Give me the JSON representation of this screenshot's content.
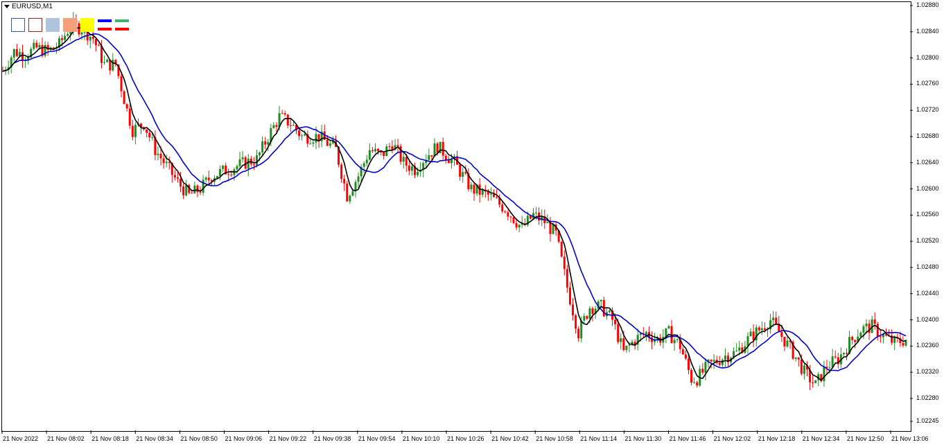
{
  "window": {
    "symbol_title": "EURUSD,M1"
  },
  "toolbox": {
    "swatches": [
      {
        "name": "outline-blue-rect-tool",
        "fill": "#ffffff",
        "border": "#3a5a8a"
      },
      {
        "name": "outline-red-rect-tool",
        "fill": "#ffffff",
        "border": "#a02020"
      },
      {
        "name": "light-blue-rect-tool",
        "fill": "#b0c4de",
        "border": "#b0c4de"
      },
      {
        "name": "salmon-rect-tool",
        "fill": "#f4a07a",
        "border": "#f4a07a"
      },
      {
        "name": "yellow-rect-tool",
        "fill": "#ffff00",
        "border": "#ffff00"
      }
    ],
    "line_tools": [
      {
        "name": "line-tool-blue-red",
        "top": "#0000ff",
        "bottom": "#ff0000"
      },
      {
        "name": "line-tool-green-red",
        "top": "#3cb371",
        "bottom": "#ff0000"
      }
    ]
  },
  "price_axis": {
    "labels": [
      "1.02880",
      "1.02840",
      "1.02800",
      "1.02760",
      "1.02720",
      "1.02680",
      "1.02640",
      "1.02600",
      "1.02560",
      "1.02520",
      "1.02480",
      "1.02440",
      "1.02400",
      "1.02360",
      "1.02320",
      "1.02280",
      "1.02245"
    ]
  },
  "time_axis": {
    "labels": [
      "21 Nov 2022",
      "21 Nov 08:02",
      "21 Nov 08:18",
      "21 Nov 08:34",
      "21 Nov 08:50",
      "21 Nov 09:06",
      "21 Nov 09:22",
      "21 Nov 09:38",
      "21 Nov 09:54",
      "21 Nov 10:10",
      "21 Nov 10:26",
      "21 Nov 10:42",
      "21 Nov 10:58",
      "21 Nov 11:14",
      "21 Nov 11:30",
      "21 Nov 11:46",
      "21 Nov 12:02",
      "21 Nov 12:18",
      "21 Nov 12:34",
      "21 Nov 12:50",
      "21 Nov 13:06"
    ]
  },
  "chart_data": {
    "type": "candlestick",
    "symbol": "EURUSD",
    "timeframe": "M1",
    "colors": {
      "bull": "#228b22",
      "bear": "#ff0000",
      "fast_ma": "#000000",
      "slow_ma": "#0000cd"
    },
    "ylim": [
      1.02245,
      1.0288
    ],
    "price_path": [
      [
        "07:46",
        1.0278
      ],
      [
        "07:50",
        1.0281
      ],
      [
        "07:54",
        1.02805
      ],
      [
        "07:58",
        1.02815
      ],
      [
        "08:02",
        1.0281
      ],
      [
        "08:06",
        1.0282
      ],
      [
        "08:10",
        1.0285
      ],
      [
        "08:14",
        1.02845
      ],
      [
        "08:18",
        1.0283
      ],
      [
        "08:22",
        1.0279
      ],
      [
        "08:26",
        1.0279
      ],
      [
        "08:30",
        1.0272
      ],
      [
        "08:32",
        1.0269
      ],
      [
        "08:36",
        1.027
      ],
      [
        "08:40",
        1.0266
      ],
      [
        "08:44",
        1.02635
      ],
      [
        "08:48",
        1.0261
      ],
      [
        "08:52",
        1.0259
      ],
      [
        "08:56",
        1.026
      ],
      [
        "09:00",
        1.0262
      ],
      [
        "09:06",
        1.0263
      ],
      [
        "09:12",
        1.0264
      ],
      [
        "09:16",
        1.02645
      ],
      [
        "09:20",
        1.0268
      ],
      [
        "09:24",
        1.0271
      ],
      [
        "09:28",
        1.027
      ],
      [
        "09:32",
        1.0268
      ],
      [
        "09:38",
        1.0268
      ],
      [
        "09:44",
        1.0266
      ],
      [
        "09:48",
        1.0259
      ],
      [
        "09:52",
        1.0262
      ],
      [
        "09:56",
        1.0266
      ],
      [
        "10:00",
        1.0265
      ],
      [
        "10:04",
        1.0267
      ],
      [
        "10:08",
        1.0264
      ],
      [
        "10:12",
        1.0263
      ],
      [
        "10:16",
        1.0265
      ],
      [
        "10:20",
        1.02665
      ],
      [
        "10:26",
        1.0264
      ],
      [
        "10:32",
        1.026
      ],
      [
        "10:38",
        1.0259
      ],
      [
        "10:44",
        1.0257
      ],
      [
        "10:50",
        1.0254
      ],
      [
        "10:54",
        1.0256
      ],
      [
        "10:58",
        1.0255
      ],
      [
        "11:02",
        1.0253
      ],
      [
        "11:06",
        1.0245
      ],
      [
        "11:10",
        1.0238
      ],
      [
        "11:14",
        1.0242
      ],
      [
        "11:18",
        1.0242
      ],
      [
        "11:22",
        1.024
      ],
      [
        "11:26",
        1.0235
      ],
      [
        "11:30",
        1.0237
      ],
      [
        "11:34",
        1.0238
      ],
      [
        "11:38",
        1.0237
      ],
      [
        "11:42",
        1.0238
      ],
      [
        "11:46",
        1.0236
      ],
      [
        "11:50",
        1.0231
      ],
      [
        "11:52",
        1.0231
      ],
      [
        "11:56",
        1.0233
      ],
      [
        "12:02",
        1.02345
      ],
      [
        "12:06",
        1.0235
      ],
      [
        "12:10",
        1.0237
      ],
      [
        "12:14",
        1.02385
      ],
      [
        "12:18",
        1.024
      ],
      [
        "12:22",
        1.02375
      ],
      [
        "12:26",
        1.0235
      ],
      [
        "12:30",
        1.0232
      ],
      [
        "12:34",
        1.023
      ],
      [
        "12:38",
        1.0233
      ],
      [
        "12:42",
        1.0234
      ],
      [
        "12:46",
        1.02365
      ],
      [
        "12:50",
        1.02385
      ],
      [
        "12:54",
        1.0239
      ],
      [
        "12:58",
        1.02375
      ],
      [
        "13:02",
        1.02365
      ],
      [
        "13:06",
        1.0237
      ]
    ],
    "fast_ma_period": 5,
    "slow_ma_period": 14
  }
}
